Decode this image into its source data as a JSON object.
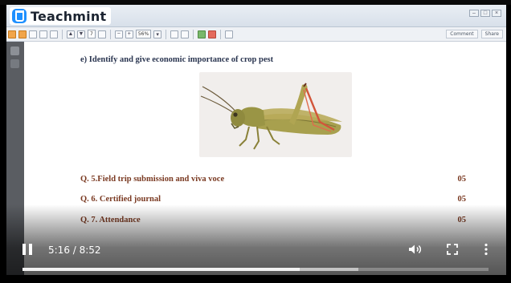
{
  "brand": {
    "name": "Teachmint"
  },
  "toolbar": {
    "page_field": "7",
    "zoom_field": "56%",
    "comment_label": "Comment",
    "share_label": "Share"
  },
  "document": {
    "question_heading": "e) Identify and give economic importance of crop pest",
    "figure_icon": "grasshopper-illustration",
    "questions": [
      {
        "label": "Q. 5.Field trip submission and viva voce",
        "marks": "05"
      },
      {
        "label": "Q. 6. Certified journal",
        "marks": "05"
      },
      {
        "label": "Q. 7. Attendance",
        "marks": "05"
      }
    ]
  },
  "player": {
    "time_display": "5:16 / 8:52",
    "progress_played": 0.595,
    "progress_buffered": 0.72,
    "icons": {
      "pause": "pause-icon",
      "volume": "volume-icon",
      "fullscreen": "fullscreen-icon",
      "more": "more-vertical-icon"
    }
  },
  "colors": {
    "question_heading": "#2a3550",
    "question_rows": "#7a3a22",
    "brand_logo": "#1e90ff"
  }
}
